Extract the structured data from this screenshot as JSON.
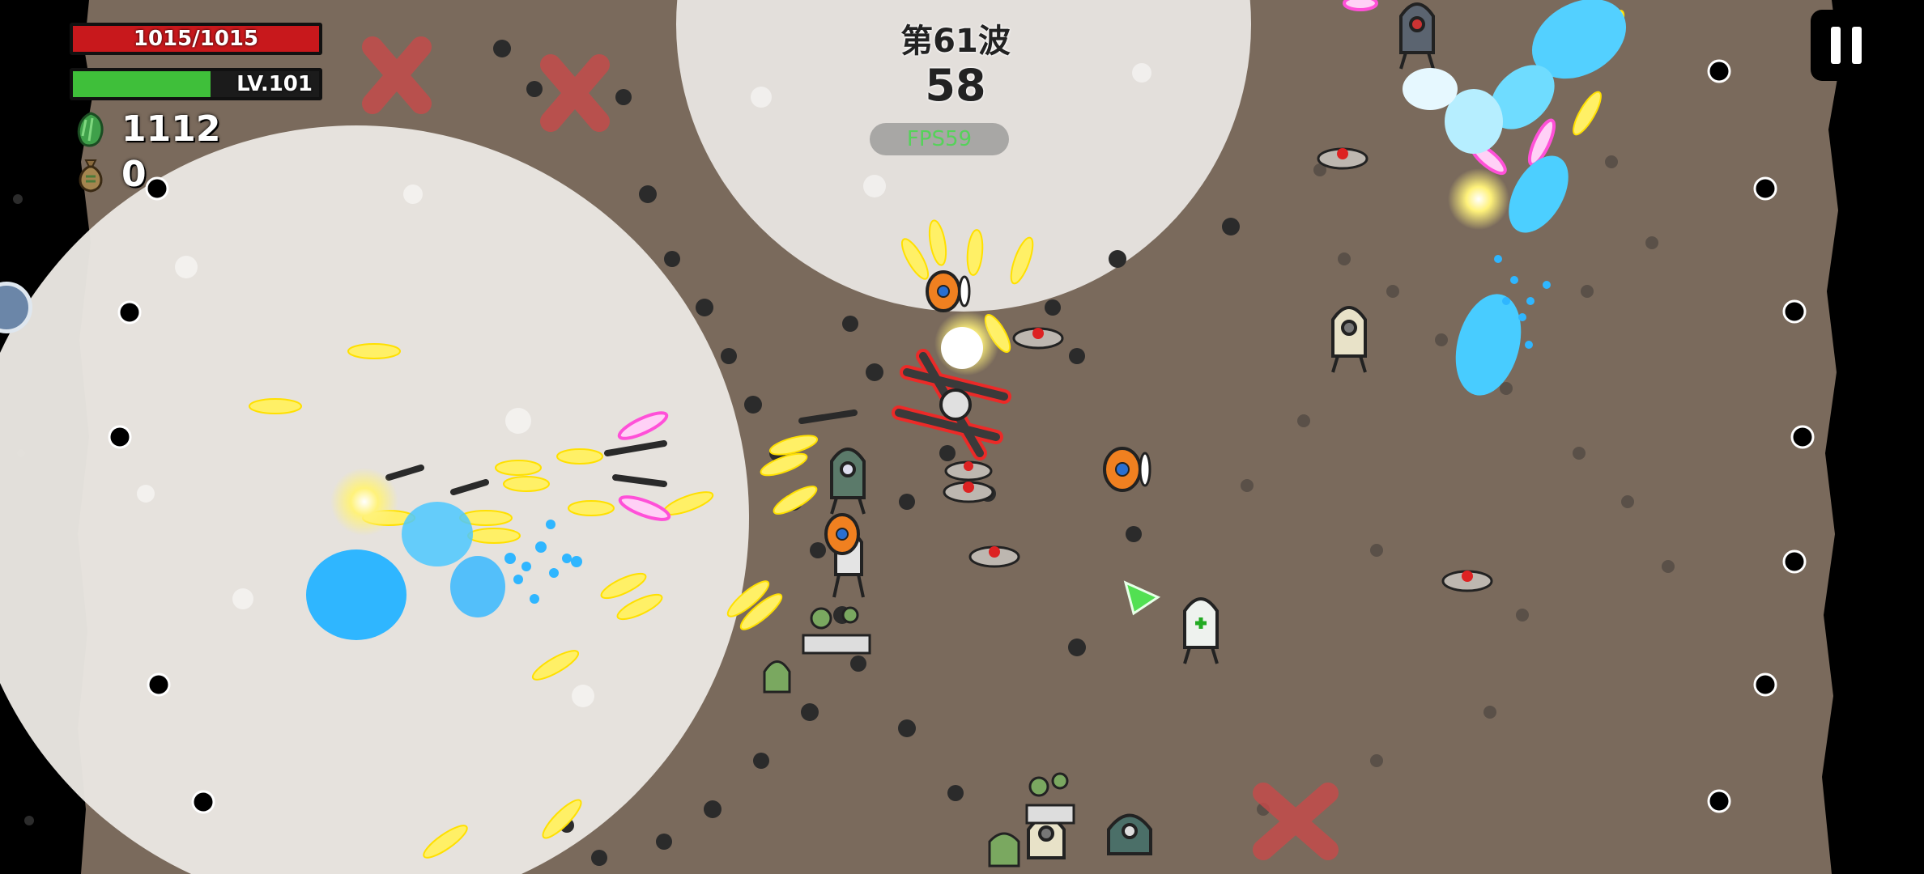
{
  "hud": {
    "hp_text": "1015/1015",
    "hp_ratio": 1.0,
    "level_text": "LV.101",
    "xp_ratio": 0.56,
    "gem_count": "1112",
    "bag_count": "0",
    "wave_label": "第61波",
    "timer": "58",
    "fps_text": "FPS59"
  },
  "icons": {
    "gem": "green-gem-icon",
    "bag": "money-bag-icon",
    "pause": "pause-icon",
    "skill": "skill-orb-icon"
  },
  "colors": {
    "ground": "#7a6a5c",
    "hp": "#c8181c",
    "xp": "#3fbf3a",
    "projectile_yellow": "#fff066",
    "projectile_cyan": "#3fd0ff",
    "projectile_pink": "#ff6adf"
  }
}
